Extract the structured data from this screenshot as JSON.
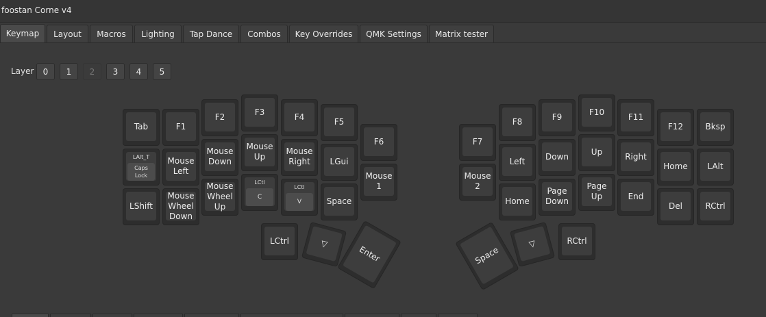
{
  "window": {
    "title": "foostan Corne v4"
  },
  "tabs": [
    "Keymap",
    "Layout",
    "Macros",
    "Lighting",
    "Tap Dance",
    "Combos",
    "Key Overrides",
    "QMK Settings",
    "Matrix tester"
  ],
  "layers": {
    "label": "Layer",
    "items": [
      "0",
      "1",
      "2",
      "3",
      "4",
      "5"
    ],
    "selected": "2"
  },
  "keys": {
    "l_tab": "Tab",
    "l_f1": "F1",
    "l_f2": "F2",
    "l_f3": "F3",
    "l_f4": "F4",
    "l_f5": "F5",
    "l_f6": "F6",
    "l_lalt_top": "LAlt_T",
    "l_lalt_inner": "Caps\nLock",
    "l_mouse_left": "Mouse\nLeft",
    "l_mouse_down": "Mouse\nDown",
    "l_mouse_up": "Mouse\nUp",
    "l_mouse_right": "Mouse\nRight",
    "l_lgui": "LGui",
    "l_mouse1": "Mouse\n1",
    "l_lshift": "LShift",
    "l_wheel_down": "Mouse\nWheel\nDown",
    "l_wheel_up": "Mouse\nWheel\nUp",
    "l_lctl_c_top": "LCtl",
    "l_lctl_c_inner": "C",
    "l_lctl_v_top": "LCtl",
    "l_lctl_v_inner": "V",
    "l_space": "Space",
    "l_lctrl": "LCtrl",
    "l_trns": "▽",
    "l_enter": "Enter",
    "r_f7": "F7",
    "r_f8": "F8",
    "r_f9": "F9",
    "r_f10": "F10",
    "r_f11": "F11",
    "r_f12": "F12",
    "r_bksp": "Bksp",
    "r_mouse2": "Mouse\n2",
    "r_left": "Left",
    "r_down": "Down",
    "r_up": "Up",
    "r_right": "Right",
    "r_home": "Home",
    "r_lalt": "LAlt",
    "r_home2": "Home",
    "r_pgdn": "Page\nDown",
    "r_pgup": "Page\nUp",
    "r_end": "End",
    "r_del": "Del",
    "r_rctrl": "RCtrl",
    "r_space": "Space",
    "r_trns": "▽",
    "r_rctrl2": "RCtrl"
  }
}
